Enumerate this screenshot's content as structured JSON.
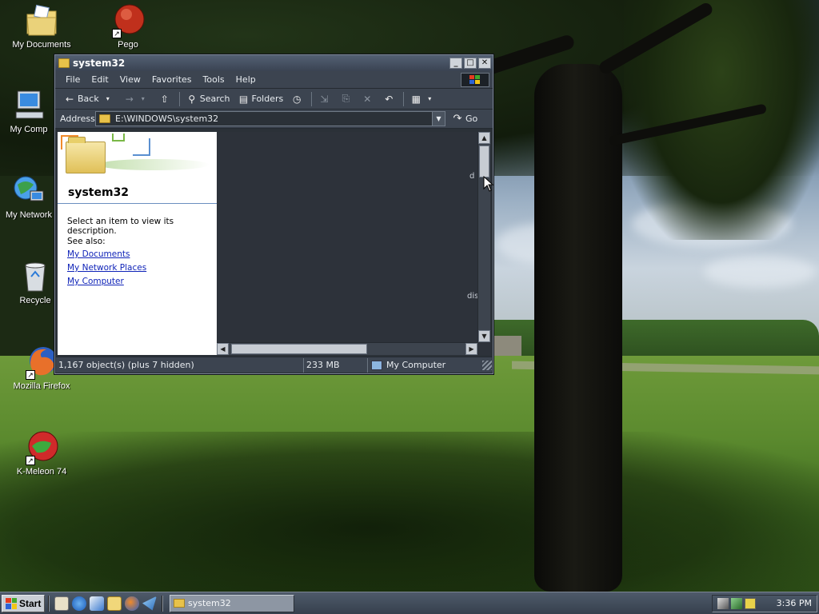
{
  "desktop": {
    "icons": [
      {
        "label": "My Documents",
        "icon": "my-documents-icon"
      },
      {
        "label": "Pego",
        "icon": "pego-icon",
        "shortcut": true
      },
      {
        "label": "My Computer",
        "icon": "my-computer-icon"
      },
      {
        "label": "My Network Places",
        "icon": "my-network-places-icon"
      },
      {
        "label": "Recycle Bin",
        "icon": "recycle-bin-icon"
      },
      {
        "label": "Mozilla Firefox",
        "icon": "firefox-icon",
        "shortcut": true
      },
      {
        "label": "K-Meleon 74",
        "icon": "k-meleon-icon",
        "shortcut": true
      }
    ],
    "visible_labels": {
      "my_computer": "My Comp",
      "my_network": "My Network",
      "recycle": "Recycle"
    }
  },
  "window": {
    "title": "system32",
    "controls": {
      "minimize": "_",
      "maximize": "□",
      "close": "✕"
    },
    "menu": [
      "File",
      "Edit",
      "View",
      "Favorites",
      "Tools",
      "Help"
    ],
    "toolbar": {
      "back": "Back",
      "search": "Search",
      "folders": "Folders"
    },
    "address": {
      "label": "Address",
      "value": "E:\\WINDOWS\\system32",
      "go": "Go"
    },
    "tasks_pane": {
      "title": "system32",
      "description": "Select an item to view its description.",
      "see_also": "See also:",
      "links": [
        "My Documents",
        "My Network Places",
        "My Computer"
      ]
    },
    "file_area": {
      "fragments": [
        "d",
        "dis"
      ]
    },
    "status": {
      "objects": "1,167 object(s) (plus 7 hidden)",
      "size": "233 MB",
      "location": "My Computer"
    }
  },
  "taskbar": {
    "start": "Start",
    "task": "system32",
    "clock": "3:36 PM"
  },
  "colors": {
    "window_bg": "#2b3138",
    "link": "#0f23b8",
    "taskbar": "#3e4957"
  }
}
